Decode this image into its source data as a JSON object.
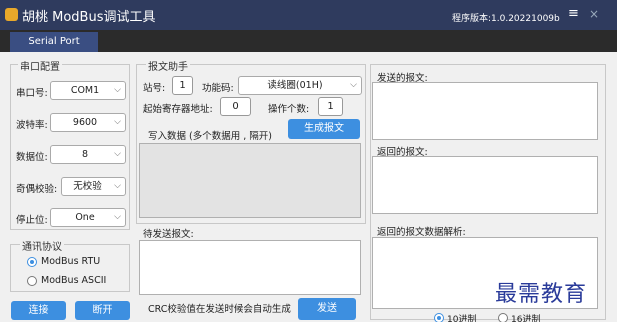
{
  "app": {
    "title": "胡桃 ModBus调试工具",
    "version": "程序版本:1.0.20221009b",
    "menu_glyph": "≡",
    "close_glyph": "×"
  },
  "tabs": [
    {
      "label": "Serial Port",
      "active": true
    }
  ],
  "serial_config": {
    "group_title": "串口配置",
    "port": {
      "label": "串口号:",
      "value": "COM1"
    },
    "baud": {
      "label": "波特率:",
      "value": "9600"
    },
    "databits": {
      "label": "数据位:",
      "value": "8"
    },
    "parity": {
      "label": "奇偶校验:",
      "value": "无校验"
    },
    "stopbits": {
      "label": "停止位:",
      "value": "One"
    }
  },
  "protocol": {
    "group_title": "通讯协议",
    "options": [
      {
        "label": "ModBus RTU",
        "checked": true
      },
      {
        "label": "ModBus ASCII",
        "checked": false
      }
    ]
  },
  "connect": {
    "connect_label": "连接",
    "disconnect_label": "断开"
  },
  "assistant": {
    "group_title": "报文助手",
    "station": {
      "label": "站号:",
      "value": "1"
    },
    "function": {
      "label": "功能码:",
      "value": "读线圈(01H)"
    },
    "start_addr": {
      "label": "起始寄存器地址:",
      "value": "0"
    },
    "count": {
      "label": "操作个数:",
      "value": "1"
    },
    "write_label": "写入数据 (多个数据用 , 隔开)",
    "generate_label": "生成报文"
  },
  "pending": {
    "label": "待发送报文:",
    "crc_note": "CRC校验值在发送时候会自动生成",
    "send_label": "发送"
  },
  "right": {
    "sent_label": "发送的报文:",
    "returned_label": "返回的报文:",
    "parse_label": "返回的报文数据解析:",
    "radix": [
      {
        "label": "10进制",
        "checked": true
      },
      {
        "label": "16进制",
        "checked": false
      }
    ]
  },
  "watermark": "最需教育",
  "colors": {
    "titlebar": "#2f3b5e",
    "tab_active": "#3a4e82",
    "button": "#3d8fe0",
    "watermark": "#2a3b9a"
  }
}
